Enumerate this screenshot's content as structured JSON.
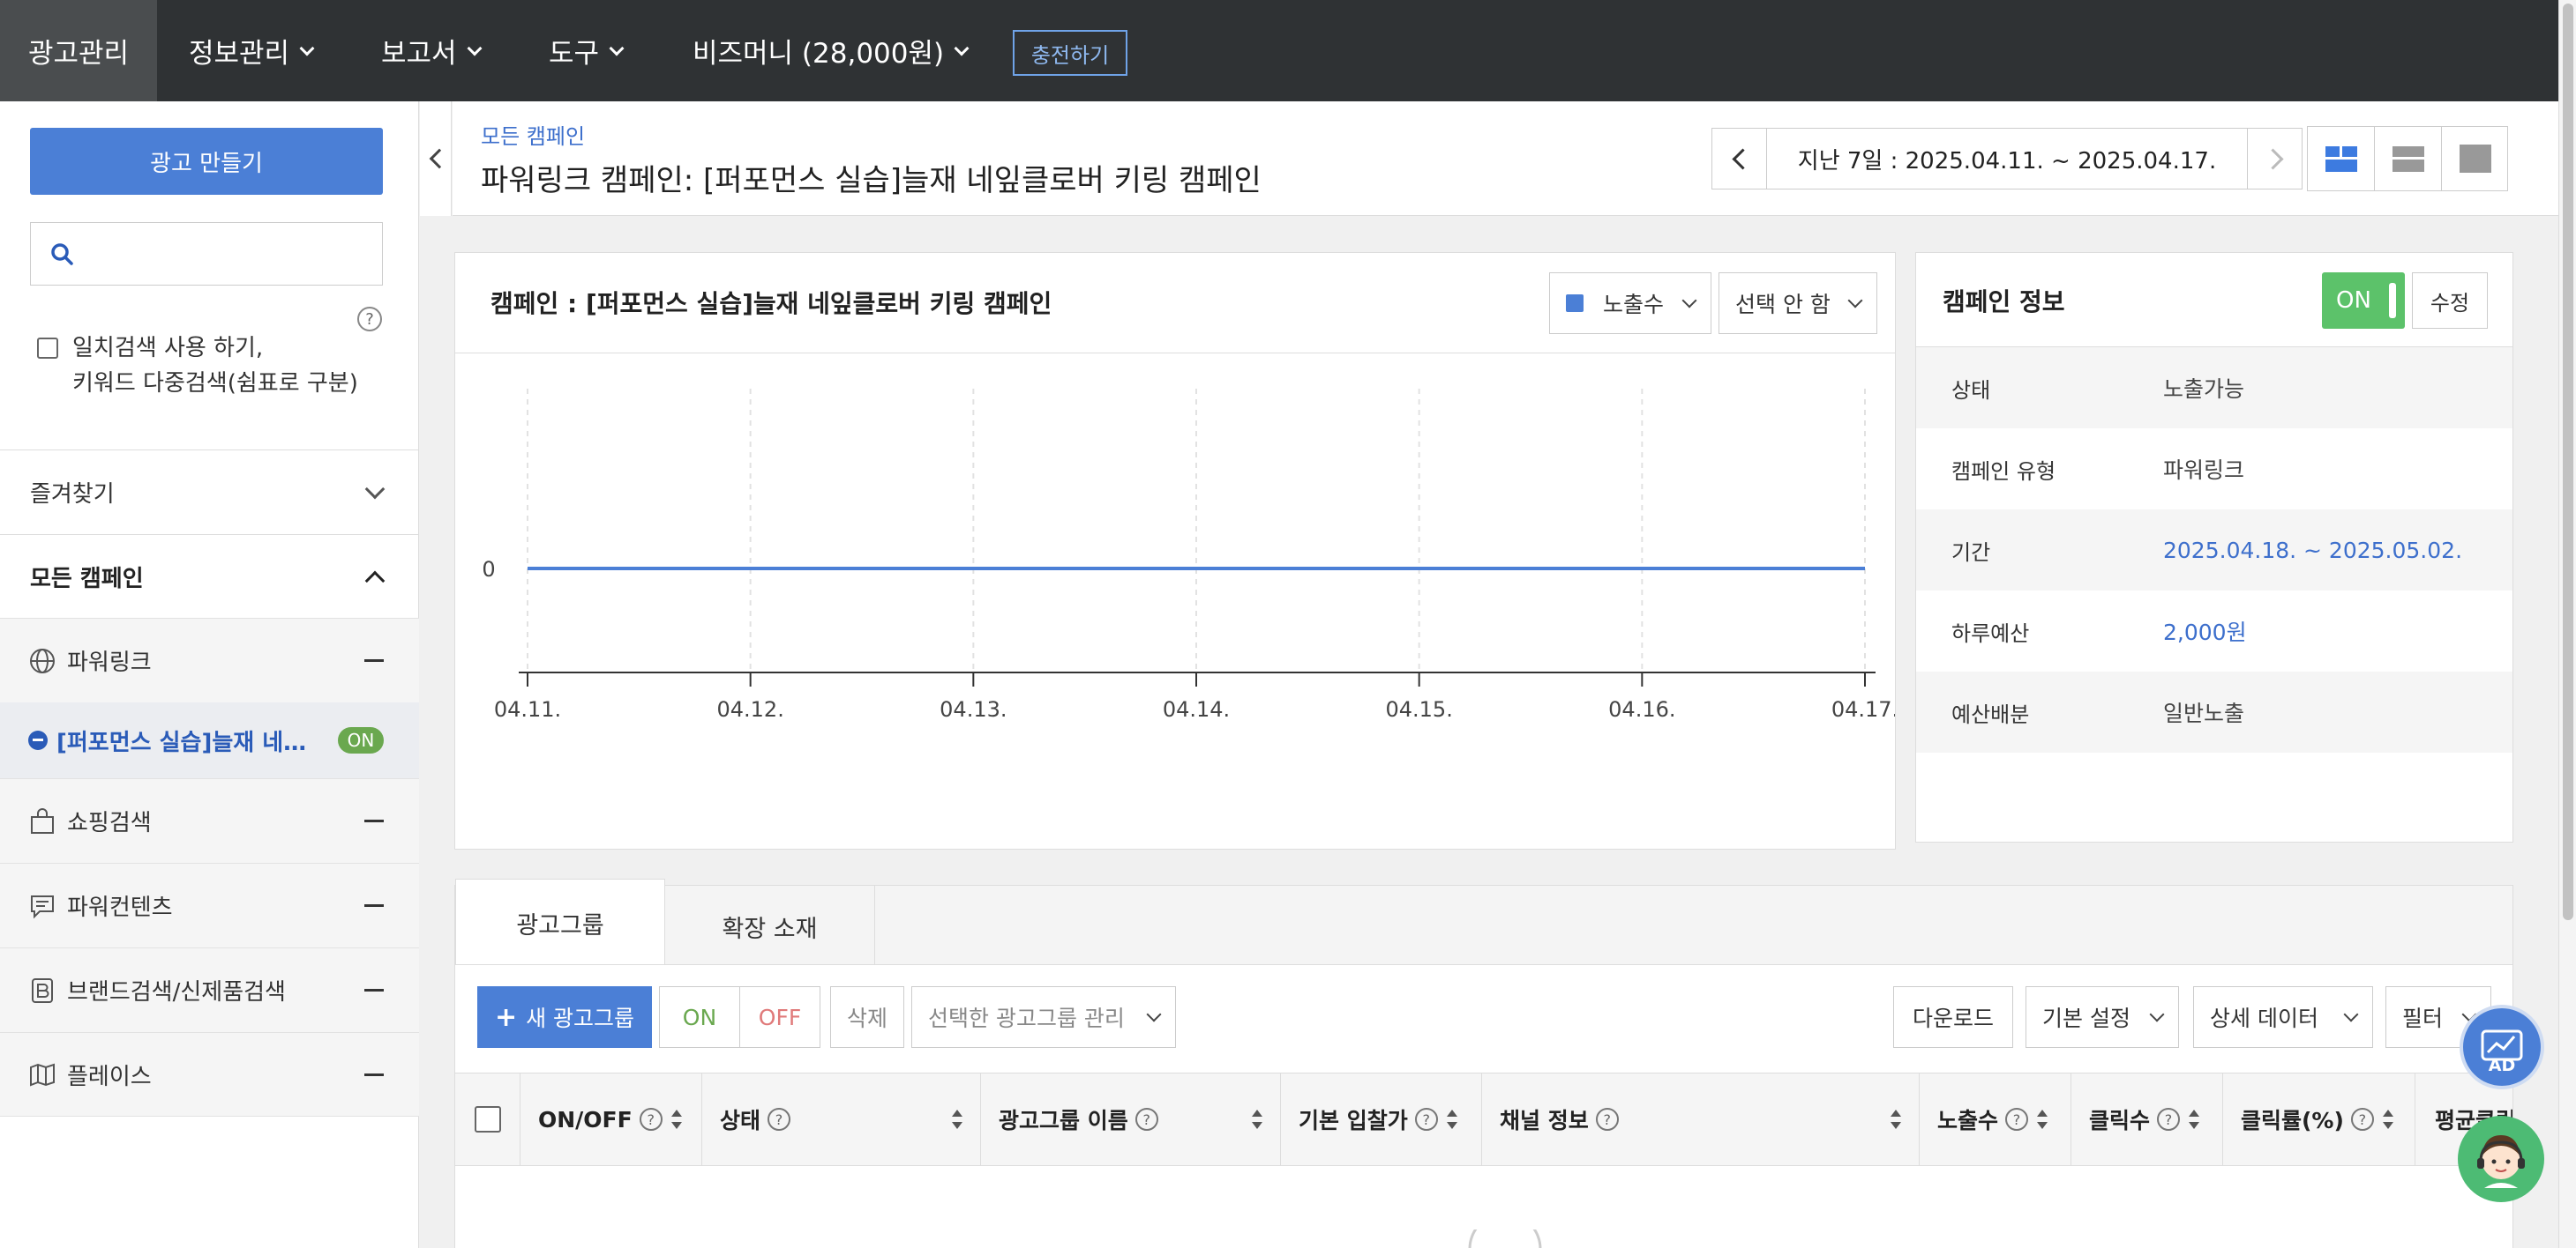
{
  "topnav": {
    "items": [
      {
        "label": "광고관리",
        "active": true,
        "dropdown": false
      },
      {
        "label": "정보관리",
        "dropdown": true
      },
      {
        "label": "보고서",
        "dropdown": true
      },
      {
        "label": "도구",
        "dropdown": true
      },
      {
        "label": "비즈머니 (28,000원)",
        "dropdown": true
      }
    ],
    "charge_label": "충전하기"
  },
  "sidebar": {
    "create_label": "광고 만들기",
    "search_placeholder": "",
    "help_glyph": "?",
    "exact_line1": "일치검색 사용 하기,",
    "exact_line2": "키워드 다중검색(쉼표로 구분)",
    "favorites_label": "즐겨찾기",
    "all_campaigns_label": "모든 캠페인",
    "items": [
      {
        "label": "파워링크",
        "icon": "globe-icon"
      },
      {
        "label": "쇼핑검색",
        "icon": "shopping-bag-icon"
      },
      {
        "label": "파워컨텐츠",
        "icon": "chat-icon"
      },
      {
        "label": "브랜드검색/신제품검색",
        "icon": "brand-b-icon"
      },
      {
        "label": "플레이스",
        "icon": "map-icon"
      }
    ],
    "active_campaign": {
      "label": "[퍼포먼스 실습]늘재 네…",
      "status": "ON"
    }
  },
  "header": {
    "breadcrumb": "모든 캠페인",
    "title": "파워링크 캠페인: [퍼포먼스 실습]늘재 네잎클로버 키링 캠페인",
    "date_range": "지난 7일 : 2025.04.11. ~ 2025.04.17."
  },
  "chart_panel": {
    "title": "캠페인 : [퍼포먼스 실습]늘재 네잎클로버 키링 캠페인",
    "metric_select": "노출수",
    "second_select": "선택 안 함",
    "line_color": "#4b7fd6"
  },
  "chart_data": {
    "type": "line",
    "x": [
      "04.11.",
      "04.12.",
      "04.13.",
      "04.14.",
      "04.15.",
      "04.16.",
      "04.17."
    ],
    "series": [
      {
        "values": [
          0,
          0,
          0,
          0,
          0,
          0,
          0
        ]
      }
    ],
    "yticks": [
      "0"
    ],
    "title": "",
    "xlabel": "",
    "ylabel": "",
    "grid": true
  },
  "info": {
    "title": "캠페인 정보",
    "toggle_label": "ON",
    "edit_label": "수정",
    "rows": [
      {
        "key": "상태",
        "value": "노출가능"
      },
      {
        "key": "캠페인 유형",
        "value": "파워링크"
      },
      {
        "key": "기간",
        "value": "2025.04.18. ~ 2025.05.02."
      },
      {
        "key": "하루예산",
        "value": "2,000원"
      },
      {
        "key": "예산배분",
        "value": "일반노출"
      }
    ]
  },
  "tabs": {
    "active": "광고그룹",
    "other": "확장 소재"
  },
  "toolbar": {
    "new_group": "새 광고그룹",
    "on": "ON",
    "off": "OFF",
    "delete": "삭제",
    "manage": "선택한 광고그룹 관리",
    "download": "다운로드",
    "basic_settings": "기본 설정",
    "detail_data": "상세 데이터",
    "filter": "필터"
  },
  "table": {
    "columns": [
      "ON/OFF",
      "상태",
      "광고그룹 이름",
      "기본 입찰가",
      "채널 정보",
      "노출수",
      "클릭수",
      "클릭률(%)",
      "평균클릭비용"
    ]
  },
  "fab": {
    "ad_label": "AD"
  },
  "colors": {
    "nav_bg": "#2f3234",
    "primary": "#4b7fd6",
    "on_green": "#5cc26a",
    "link_blue": "#3d6fcc"
  }
}
